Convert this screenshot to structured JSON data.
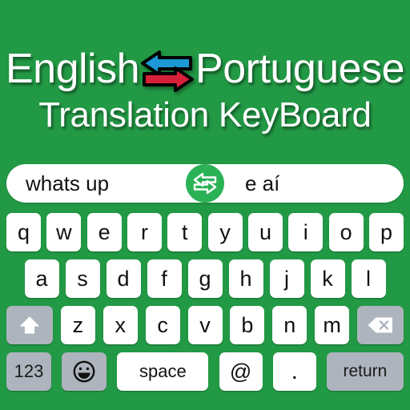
{
  "app": {
    "background_color": "#229945",
    "title_line_1_left": "English",
    "title_line_1_right": "Portuguese",
    "title_line_2": "Translation KeyBoard",
    "title_color": "#ffffff",
    "swap_icon_left_color": "#1c9ad6",
    "swap_icon_right_color": "#d6203a"
  },
  "translate_bar": {
    "source_text": "whats up",
    "target_text": "e aí",
    "swap_button_icon": "swap-horizontal-icon",
    "swap_button_color": "#2bb257",
    "bar_color": "#ffffff"
  },
  "keyboard": {
    "key_color": "#ffffff",
    "modifier_key_color": "#aeb4bd",
    "row1": [
      {
        "label": "q"
      },
      {
        "label": "w"
      },
      {
        "label": "e"
      },
      {
        "label": "r"
      },
      {
        "label": "t"
      },
      {
        "label": "y"
      },
      {
        "label": "u"
      },
      {
        "label": "i"
      },
      {
        "label": "o"
      },
      {
        "label": "p"
      }
    ],
    "row2": [
      {
        "label": "a"
      },
      {
        "label": "s"
      },
      {
        "label": "d"
      },
      {
        "label": "f"
      },
      {
        "label": "g"
      },
      {
        "label": "h"
      },
      {
        "label": "j"
      },
      {
        "label": "k"
      },
      {
        "label": "l"
      }
    ],
    "row3_shift": {
      "icon": "shift-arrow-icon",
      "label": ""
    },
    "row3": [
      {
        "label": "z"
      },
      {
        "label": "x"
      },
      {
        "label": "c"
      },
      {
        "label": "v"
      },
      {
        "label": "b"
      },
      {
        "label": "n"
      },
      {
        "label": "m"
      }
    ],
    "row3_backspace": {
      "icon": "backspace-icon",
      "label": ""
    },
    "row4": {
      "numeric": "123",
      "emoji": {
        "icon": "smiley-face-icon",
        "label": ""
      },
      "space": "space",
      "at": "@",
      "period": ".",
      "return": "return"
    }
  }
}
